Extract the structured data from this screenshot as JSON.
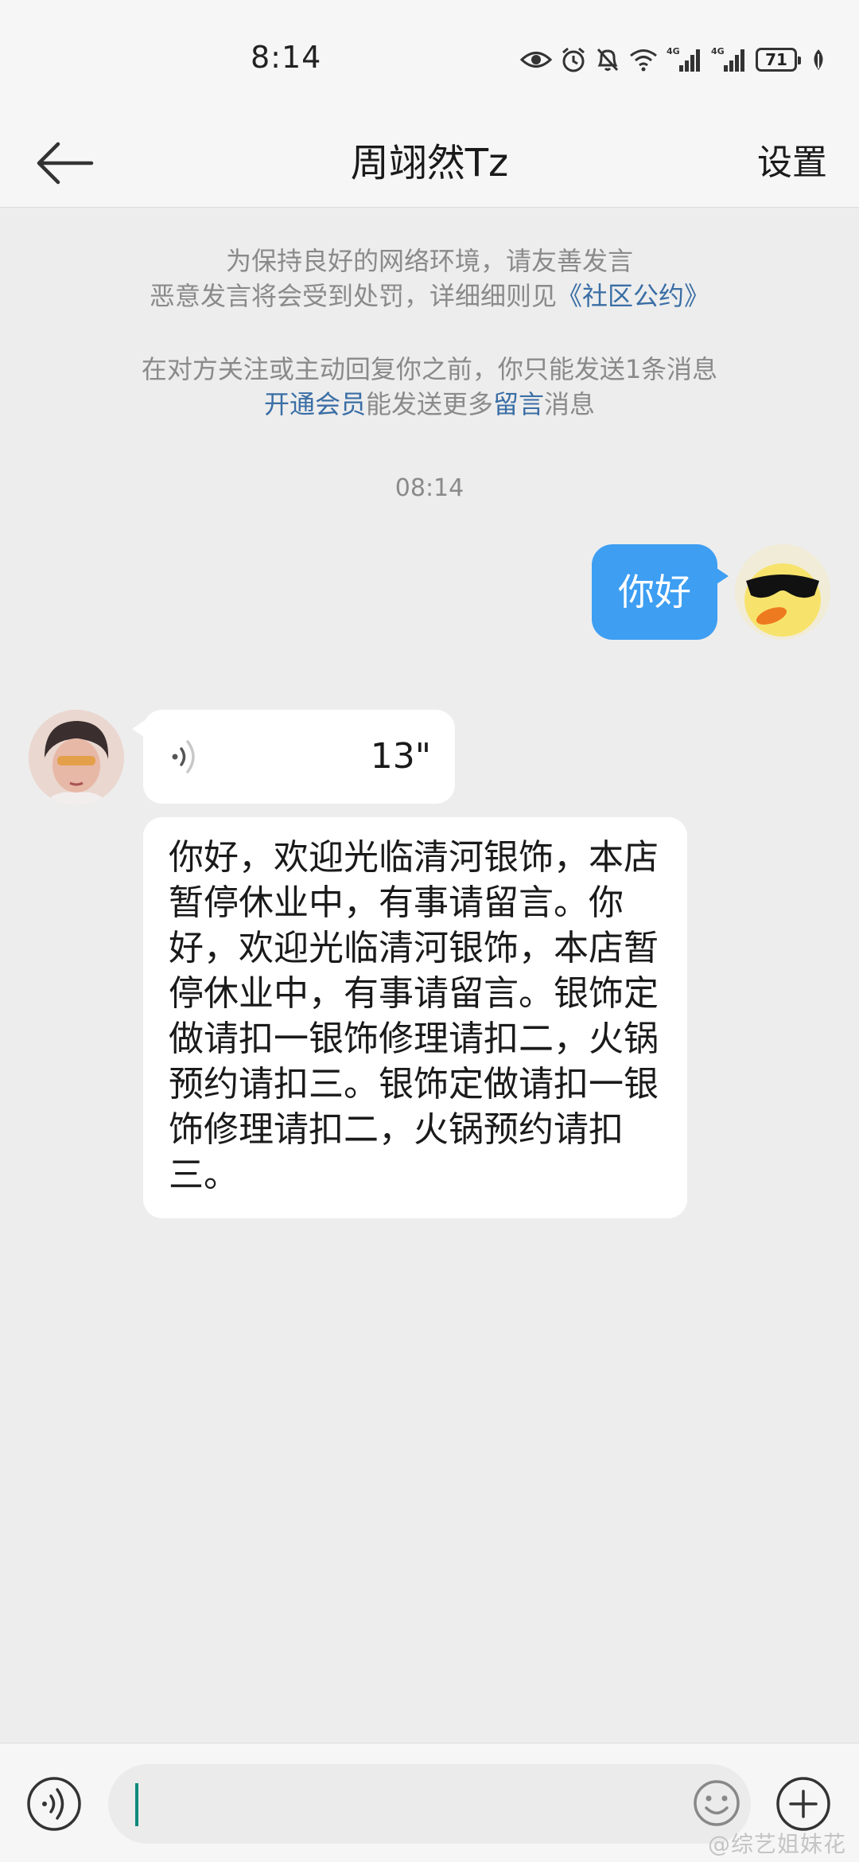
{
  "status_bar": {
    "time": "8:14",
    "network_1": "4G",
    "network_2": "4G",
    "battery": "71"
  },
  "header": {
    "title": "周翊然Tz",
    "settings_label": "设置"
  },
  "notices": {
    "line1": "为保持良好的网络环境，请友善发言",
    "line2_prefix": "恶意发言将会受到处罚，详细细则见",
    "line2_link": "《社区公约》",
    "line3": "在对方关注或主动回复你之前，你只能发送1条消息",
    "line4_link1": "开通会员",
    "line4_mid": "能发送更多",
    "line4_link2": "留言",
    "line4_suffix": "消息"
  },
  "timestamp": "08:14",
  "messages": {
    "outgoing": {
      "text": "你好"
    },
    "voice": {
      "duration": "13\""
    },
    "incoming_text": "你好，欢迎光临清河银饰，本店暂停休业中，有事请留言。你好，欢迎光临清河银饰，本店暂停休业中，有事请留言。银饰定做请扣一银饰修理请扣二，火锅预约请扣三。银饰定做请扣一银饰修理请扣二，火锅预约请扣三。"
  },
  "input": {
    "value": "",
    "placeholder": ""
  },
  "watermark": "@综艺姐妹花",
  "colors": {
    "outgoing_bubble": "#3d9ef2",
    "link": "#3a6ea5",
    "caret": "#0a8a7a"
  },
  "icons": {
    "back": "arrow-left-icon",
    "voice": "voice-wave-icon",
    "emoji": "smiley-icon",
    "plus": "plus-circle-icon"
  }
}
